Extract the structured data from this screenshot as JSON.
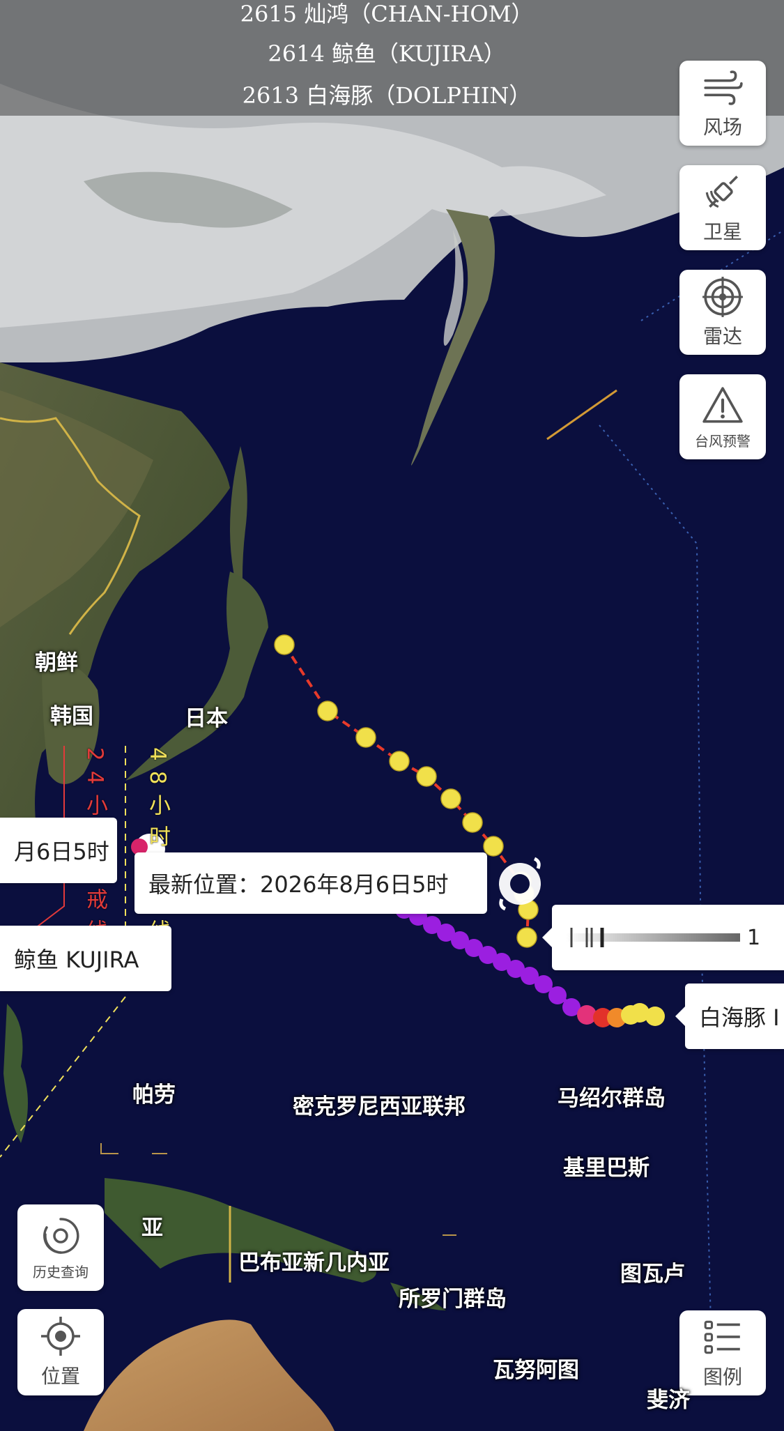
{
  "storm_list": [
    "2615 灿鸿（CHAN-HOM）",
    "2614 鲸鱼（KUJIRA）",
    "2613 白海豚（DOLPHIN）"
  ],
  "side_buttons": {
    "wind": "风场",
    "satellite": "卫星",
    "radar": "雷达",
    "typhoon_warning": "台风预警",
    "legend": "图例"
  },
  "bottom_buttons": {
    "history": "历史查询",
    "location": "位置"
  },
  "places": {
    "north_korea": "朝鲜",
    "south_korea": "韩国",
    "japan": "日本",
    "palau": "帕劳",
    "micronesia": "密克罗尼西亚联邦",
    "marshall": "马绍尔群岛",
    "kiribati": "基里巴斯",
    "png": "巴布亚新几内亚",
    "png_partial": "亚",
    "solomon": "所罗门群岛",
    "tuvalu": "图瓦卢",
    "vanuatu": "瓦努阿图",
    "fiji": "斐济"
  },
  "warning_lines": {
    "h24": "24小时警戒线",
    "h48": "48小时警戒线"
  },
  "labels": {
    "latest_position": "最新位置：2026年8月6日5时",
    "time_partial": "月6日5时",
    "kujira": "鲸鱼 KUJIRA",
    "dolphin": "白海豚 I",
    "scale_value": "1"
  },
  "colors": {
    "track_yellow": "#f1e04a",
    "track_purple": "#9b1fe0",
    "track_red": "#e2322a",
    "line_24h": "#e23a3a",
    "line_48h": "#f0e05a"
  }
}
